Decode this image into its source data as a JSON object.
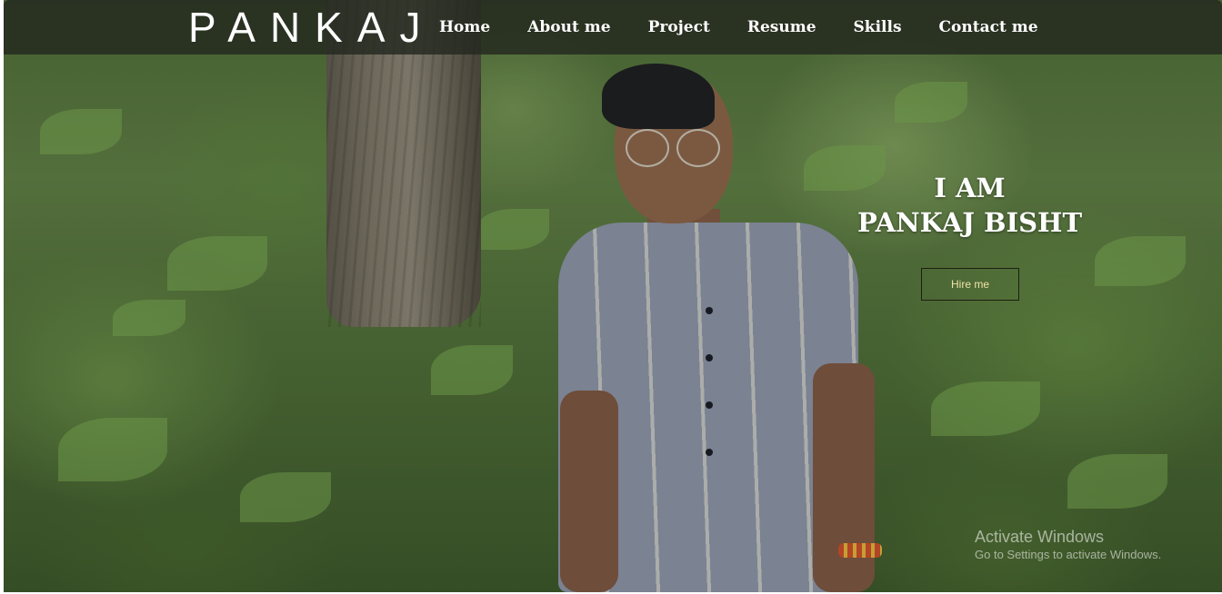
{
  "header": {
    "brand": "PANKAJ",
    "nav": [
      {
        "label": "Home"
      },
      {
        "label": "About me"
      },
      {
        "label": "Project"
      },
      {
        "label": "Resume"
      },
      {
        "label": "Skills"
      },
      {
        "label": "Contact me"
      }
    ]
  },
  "hero": {
    "line1": "I AM",
    "line2": "PANKAJ BISHT",
    "button_label": "Hire me",
    "background_image": "forest-portrait-photo"
  },
  "watermark": {
    "title": "Activate Windows",
    "subtitle": "Go to Settings to activate Windows."
  },
  "colors": {
    "navbar_bg": "#23281e",
    "text": "#ffffff",
    "button_text": "#f0e2a8",
    "button_border": "#1e1e12"
  }
}
